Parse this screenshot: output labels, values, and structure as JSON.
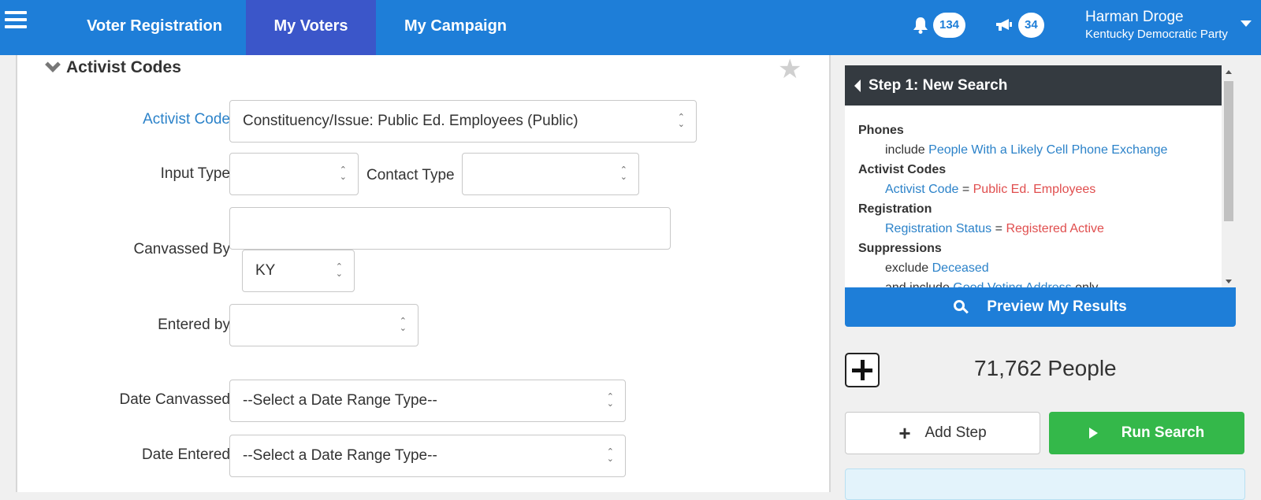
{
  "nav": {
    "tabs": [
      {
        "label": "Voter Registration"
      },
      {
        "label": "My Voters",
        "active": true
      },
      {
        "label": "My Campaign"
      }
    ],
    "notifications": {
      "icon": "bell-icon",
      "count": "134"
    },
    "announcements": {
      "icon": "megaphone-icon",
      "count": "34"
    },
    "user": {
      "name": "Harman Droge",
      "org": "Kentucky Democratic Party"
    }
  },
  "section": {
    "title": "Activist Codes",
    "fields": {
      "activist_code": {
        "label": "Activist Code",
        "value": "Constituency/Issue: Public Ed. Employees (Public)"
      },
      "input_type": {
        "label": "Input Type",
        "value": ""
      },
      "contact_type": {
        "label": "Contact Type",
        "value": ""
      },
      "canvassed_by": {
        "label": "Canvassed By",
        "value": "",
        "state": "KY"
      },
      "entered_by": {
        "label": "Entered by",
        "value": ""
      },
      "date_canvassed": {
        "label": "Date Canvassed",
        "value": "--Select a Date Range Type--"
      },
      "date_entered": {
        "label": "Date Entered",
        "value": "--Select a Date Range Type--"
      }
    }
  },
  "step": {
    "title": "Step 1: New Search",
    "criteria": {
      "phones": {
        "category": "Phones",
        "prefix": "include",
        "link": "People With a Likely Cell Phone Exchange"
      },
      "activist": {
        "category": "Activist Codes",
        "field": "Activist Code",
        "eq": "=",
        "value": "Public Ed. Employees"
      },
      "registration": {
        "category": "Registration",
        "field": "Registration Status",
        "eq": "=",
        "value": "Registered Active"
      },
      "suppressions": {
        "category": "Suppressions",
        "prefix": "exclude",
        "link": "Deceased",
        "prefix2": "and include",
        "link2": "Good Voting Address",
        "suffix2": "only"
      }
    }
  },
  "preview_label": "Preview My Results",
  "people_count": "71,762 People",
  "add_step_label": "Add Step",
  "run_search_label": "Run Search",
  "colors": {
    "nav": "#1e7ed8",
    "nav_active": "#3b56c9",
    "run": "#34b84a",
    "link": "#2b82c9",
    "value": "#e04e4e"
  }
}
